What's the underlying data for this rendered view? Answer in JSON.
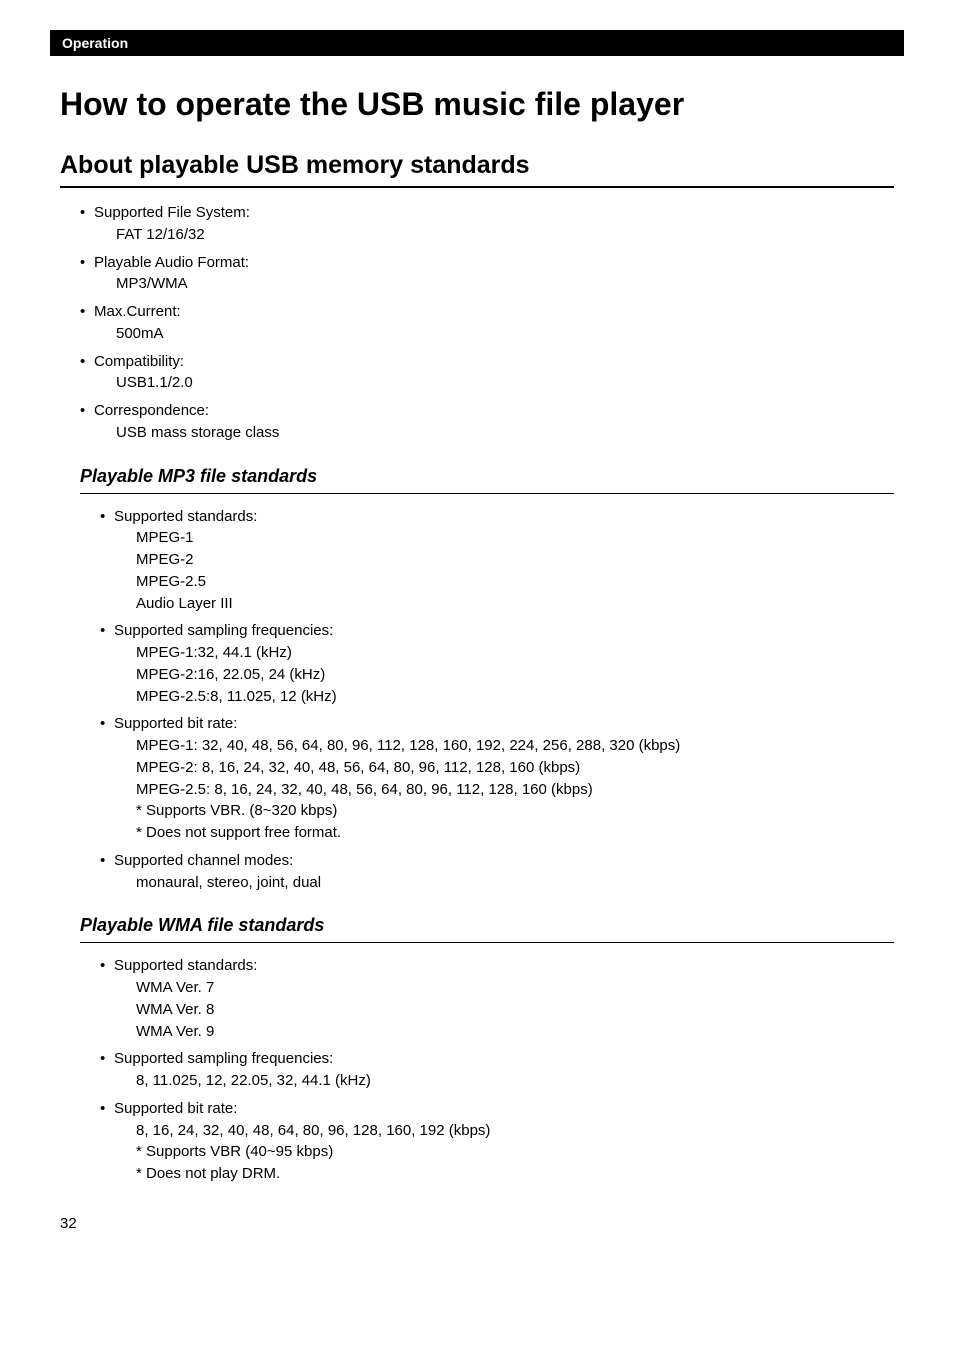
{
  "header": {
    "category": "Operation"
  },
  "title": "How to operate the USB music file player",
  "section": {
    "heading": "About playable USB memory standards",
    "items": [
      {
        "label": "Supported File System:",
        "values": [
          "FAT 12/16/32"
        ]
      },
      {
        "label": "Playable Audio Format:",
        "values": [
          "MP3/WMA"
        ]
      },
      {
        "label": "Max.Current:",
        "values": [
          "500mA"
        ]
      },
      {
        "label": "Compatibility:",
        "values": [
          "USB1.1/2.0"
        ]
      },
      {
        "label": "Correspondence:",
        "values": [
          "USB mass storage class"
        ]
      }
    ]
  },
  "mp3": {
    "heading": "Playable MP3 file standards",
    "items": [
      {
        "label": "Supported standards:",
        "values": [
          "MPEG-1",
          "MPEG-2",
          "MPEG-2.5",
          "Audio Layer III"
        ]
      },
      {
        "label": "Supported sampling frequencies:",
        "values": [
          "MPEG-1:32, 44.1 (kHz)",
          "MPEG-2:16, 22.05, 24 (kHz)",
          "MPEG-2.5:8, 11.025, 12 (kHz)"
        ]
      },
      {
        "label": "Supported bit rate:",
        "values": [
          "MPEG-1: 32, 40, 48, 56, 64, 80, 96, 112, 128, 160, 192, 224, 256, 288, 320 (kbps)",
          "MPEG-2: 8, 16, 24, 32, 40, 48, 56, 64, 80, 96, 112, 128, 160 (kbps)",
          "MPEG-2.5: 8, 16, 24, 32, 40, 48, 56, 64, 80, 96, 112, 128, 160 (kbps)",
          "* Supports VBR. (8~320 kbps)",
          "* Does not support free format."
        ]
      },
      {
        "label": "Supported channel modes:",
        "values": [
          "monaural, stereo, joint, dual"
        ]
      }
    ]
  },
  "wma": {
    "heading": "Playable WMA file standards",
    "items": [
      {
        "label": "Supported standards:",
        "values": [
          "WMA Ver. 7",
          "WMA Ver. 8",
          "WMA Ver. 9"
        ]
      },
      {
        "label": "Supported sampling frequencies:",
        "values": [
          "8, 11.025, 12, 22.05, 32, 44.1 (kHz)"
        ]
      },
      {
        "label": "Supported bit rate:",
        "values": [
          "8, 16, 24, 32, 40, 48, 64, 80, 96, 128, 160, 192 (kbps)",
          "* Supports VBR (40~95 kbps)",
          "* Does not play DRM."
        ]
      }
    ]
  },
  "pageNumber": "32"
}
